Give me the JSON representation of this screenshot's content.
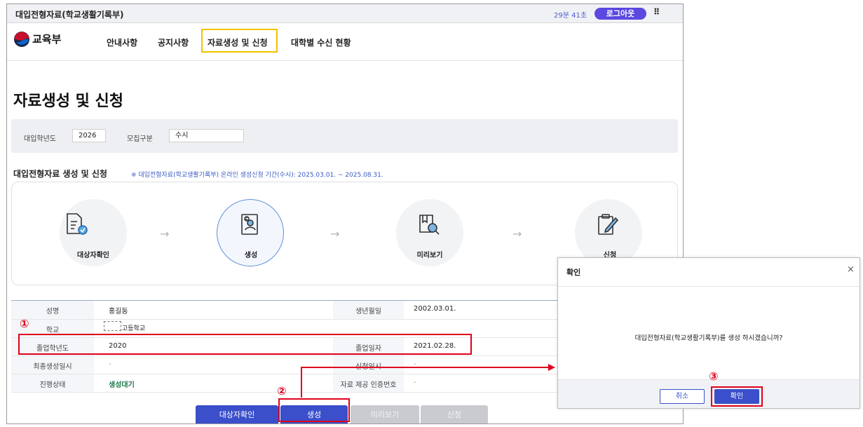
{
  "window": {
    "title": "대입전형자료(학교생활기록부)",
    "timer": "29분 41초",
    "logout_label": "로그아웃",
    "menu_dots": "⠿"
  },
  "brand": {
    "name": "교육부"
  },
  "nav": {
    "items": [
      {
        "label": "안내사항"
      },
      {
        "label": "공지사항"
      },
      {
        "label": "자료생성 및 신청"
      },
      {
        "label": "대학별 수신 현황"
      }
    ],
    "active_index": 2
  },
  "page": {
    "title": "자료생성 및 신청"
  },
  "filter": {
    "year_label": "대입학년도",
    "year_value": "2026",
    "type_label": "모집구분",
    "type_value": "수시"
  },
  "section": {
    "title": "대입전형자료 생성 및 신청",
    "note": "※ 대입전형자료(학교생활기록부) 온라인 생성신청 기간(수시): 2025.03.01. ~ 2025.08.31."
  },
  "steps": [
    {
      "label": "대상자확인",
      "icon": "document-check-icon",
      "state": "done"
    },
    {
      "label": "생성",
      "icon": "document-user-icon",
      "state": "active"
    },
    {
      "label": "미리보기",
      "icon": "book-search-icon",
      "state": "pending"
    },
    {
      "label": "신청",
      "icon": "clipboard-pen-icon",
      "state": "pending"
    }
  ],
  "step_arrow": "→",
  "info": {
    "name_label": "성명",
    "name_value": "홍길동",
    "birth_label": "생년월일",
    "birth_value": "2002.03.01.",
    "school_label": "학교",
    "school_value": "고등학교",
    "grad_year_label": "졸업학년도",
    "grad_year_value": "2020",
    "grad_date_label": "졸업일자",
    "grad_date_value": "2021.02.28.",
    "last_created_label": "최종생성일시",
    "last_created_value": "-",
    "applied_label": "신청일시",
    "applied_value": "-",
    "status_label": "진행상태",
    "status_value": "생성대기",
    "cert_label": "자료 제공 인증번호",
    "cert_value": "-"
  },
  "actions": {
    "verify_label": "대상자확인",
    "create_label": "생성",
    "preview_label": "미리보기",
    "apply_label": "신청"
  },
  "dialog": {
    "title": "확인",
    "close": "×",
    "message": "대입전형자료(학교생활기록부)를 생성 하시겠습니까?",
    "cancel_label": "취소",
    "confirm_label": "확인"
  },
  "annotations": {
    "n1": "①",
    "n2": "②",
    "n3": "③"
  },
  "colors": {
    "accent": "#3a4fc9",
    "logout": "#5a48e0",
    "highlight_yellow": "#f2c200",
    "annotation_red": "#e0001b",
    "status_green": "#1e7a4a"
  }
}
